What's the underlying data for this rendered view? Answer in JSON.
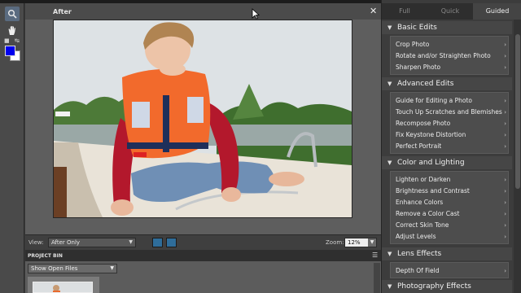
{
  "document": {
    "title": "After",
    "close_glyph": "✕"
  },
  "toolbox": {
    "tools": [
      {
        "name": "zoom",
        "icon": "zoom-icon",
        "glyph": "🔍"
      },
      {
        "name": "hand",
        "icon": "hand-icon",
        "glyph": "✋"
      }
    ],
    "foreground_color": "#0000ee",
    "background_color": "#ffffff"
  },
  "viewbar": {
    "view_label": "View:",
    "view_value": "After Only",
    "zoom_label": "Zoom:",
    "zoom_value": "12%"
  },
  "project_bin": {
    "title": "PROJECT BIN",
    "show_value": "Show Open Files"
  },
  "panel": {
    "tabs": [
      {
        "label": "Full",
        "active": false
      },
      {
        "label": "Quick",
        "active": false
      },
      {
        "label": "Guided",
        "active": true
      }
    ],
    "sections": [
      {
        "title": "Basic Edits",
        "items": [
          "Crop Photo",
          "Rotate and/or Straighten Photo",
          "Sharpen Photo"
        ]
      },
      {
        "title": "Advanced Edits",
        "items": [
          "Guide for Editing a Photo",
          "Touch Up Scratches and Blemishes",
          "Recompose Photo",
          "Fix Keystone Distortion",
          "Perfect Portrait"
        ]
      },
      {
        "title": "Color and Lighting",
        "items": [
          "Lighten or Darken",
          "Brightness and Contrast",
          "Enhance Colors",
          "Remove a Color Cast",
          "Correct Skin Tone",
          "Adjust Levels"
        ]
      },
      {
        "title": "Lens Effects",
        "items": [
          "Depth Of Field"
        ]
      },
      {
        "title": "Photography Effects",
        "items": []
      }
    ]
  },
  "colors": {
    "accent_blue": "#2f6d9a",
    "panel_bg": "#3c3c3c",
    "active_tab_text": "#f2f2f2"
  }
}
